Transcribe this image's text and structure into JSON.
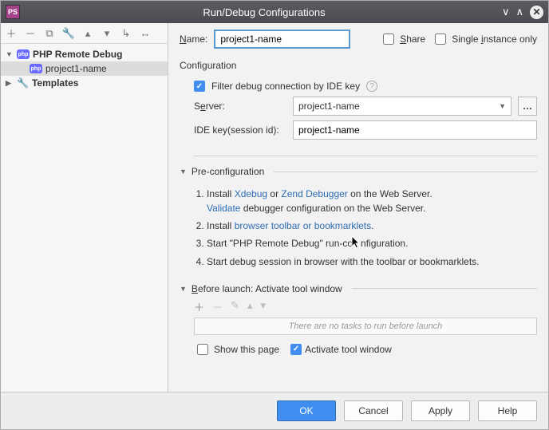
{
  "window": {
    "title": "Run/Debug Configurations",
    "app_icon_text": "PS"
  },
  "tree": {
    "php_remote_debug": "PHP Remote Debug",
    "child_name": "project1-name",
    "templates": "Templates"
  },
  "name_row": {
    "label": "Name:",
    "value": "project1-name",
    "share": "Share",
    "single_instance": "Single instance only"
  },
  "config": {
    "heading": "Configuration",
    "filter_label": "Filter debug connection by IDE key",
    "server_label": "Server:",
    "server_value": "project1-name",
    "ide_key_label": "IDE key(session id):",
    "ide_key_value": "project1-name"
  },
  "preconfig": {
    "heading": "Pre-configuration",
    "step1_a": "Install ",
    "step1_xdebug": "Xdebug",
    "step1_or": " or ",
    "step1_zend": "Zend Debugger",
    "step1_b": " on the Web Server.",
    "step1c_validate": "Validate",
    "step1c_rest": " debugger configuration on the Web Server.",
    "step2_a": "Install ",
    "step2_link": "browser toolbar or bookmarklets",
    "step2_b": ".",
    "step3": "Start \"PHP Remote Debug\" run-configuration.",
    "step4": "Start debug session in browser with the toolbar or bookmarklets."
  },
  "before_launch": {
    "heading": "Before launch: Activate tool window",
    "placeholder": "There are no tasks to run before launch",
    "show_page": "Show this page",
    "activate": "Activate tool window"
  },
  "footer": {
    "ok": "OK",
    "cancel": "Cancel",
    "apply": "Apply",
    "help": "Help"
  }
}
